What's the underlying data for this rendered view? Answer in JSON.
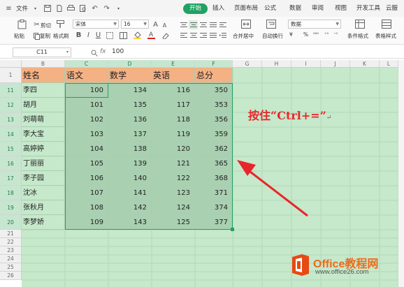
{
  "menu": {
    "file_label": "文件",
    "tabs": [
      "开始",
      "插入",
      "页面布局",
      "公式",
      "数据",
      "审阅",
      "视图",
      "开发工具",
      "云服"
    ],
    "active_tab": "开始"
  },
  "ribbon": {
    "cut": "剪切",
    "paste": "粘贴",
    "copy": "复制",
    "format_painter": "格式刷",
    "font_name": "宋体",
    "font_size": "16",
    "merge_center": "合并居中",
    "wrap_text": "自动换行",
    "number_format": "数据",
    "conditional_format": "条件格式",
    "table_style": "表格样式"
  },
  "formula_bar": {
    "name_box": "C11",
    "fx": "fx",
    "value": "100"
  },
  "columns": [
    "B",
    "C",
    "D",
    "E",
    "F",
    "G",
    "H",
    "I",
    "J",
    "K",
    "L"
  ],
  "row_numbers": [
    "1",
    "11",
    "12",
    "13",
    "14",
    "15",
    "16",
    "17",
    "18",
    "19",
    "20",
    "21",
    "22",
    "23",
    "24",
    "25",
    "26"
  ],
  "table": {
    "headers": [
      "姓名",
      "语文",
      "数学",
      "英语",
      "总分"
    ],
    "rows": [
      [
        "李四",
        "100",
        "134",
        "116",
        "350"
      ],
      [
        "胡月",
        "101",
        "135",
        "117",
        "353"
      ],
      [
        "刘萌萌",
        "102",
        "136",
        "118",
        "356"
      ],
      [
        "李大宝",
        "103",
        "137",
        "119",
        "359"
      ],
      [
        "高婷婷",
        "104",
        "138",
        "120",
        "362"
      ],
      [
        "丁丽丽",
        "105",
        "139",
        "121",
        "365"
      ],
      [
        "李子园",
        "106",
        "140",
        "122",
        "368"
      ],
      [
        "沈冰",
        "107",
        "141",
        "123",
        "371"
      ],
      [
        "张秋月",
        "108",
        "142",
        "124",
        "374"
      ],
      [
        "李梦娇",
        "109",
        "143",
        "125",
        "377"
      ]
    ]
  },
  "annotation": {
    "text_prefix": "按住",
    "key_combo": "“Ctrl+=”",
    "return_mark": "↵"
  },
  "watermark": {
    "brand": "Office教程网",
    "site": "www.office26.com"
  },
  "colors": {
    "accent": "#21a163",
    "header_fill": "#f4b183",
    "selection_fill": "#a9d0b1",
    "sheet_bg": "#c6e8cb",
    "annotation": "#e8262a",
    "arrow": "#e8262a"
  }
}
